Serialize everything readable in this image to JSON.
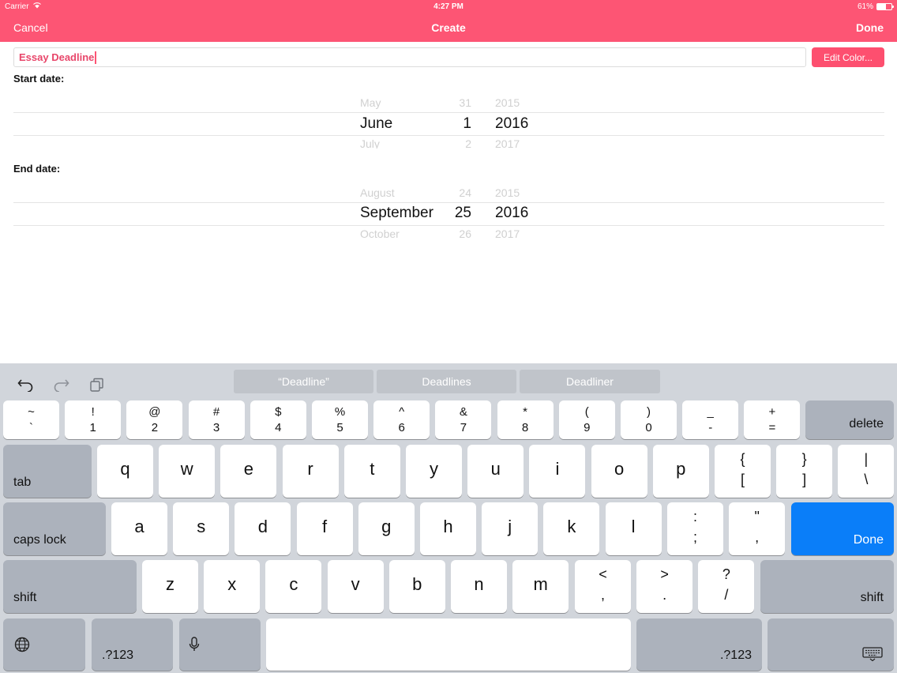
{
  "status_bar": {
    "carrier": "Carrier",
    "time": "4:27 PM",
    "battery_text": "61%",
    "battery_level": 0.61
  },
  "nav": {
    "cancel": "Cancel",
    "title": "Create",
    "done": "Done"
  },
  "form": {
    "name_value": "Essay Deadline",
    "edit_color_label": "Edit Color...",
    "start_label": "Start date:",
    "end_label": "End date:"
  },
  "start_picker": {
    "above": {
      "month": "May",
      "day": "31",
      "year": "2015"
    },
    "selected": {
      "month": "June",
      "day": "1",
      "year": "2016"
    },
    "below": {
      "month": "July",
      "day": "2",
      "year": "2017"
    }
  },
  "end_picker": {
    "above": {
      "month": "August",
      "day": "24",
      "year": "2015"
    },
    "selected": {
      "month": "September",
      "day": "25",
      "year": "2016"
    },
    "below": {
      "month": "October",
      "day": "26",
      "year": "2017"
    }
  },
  "keyboard": {
    "suggestions": [
      "“Deadline”",
      "Deadlines",
      "Deadliner"
    ],
    "row1": [
      {
        "top": "~",
        "bot": "`"
      },
      {
        "top": "!",
        "bot": "1"
      },
      {
        "top": "@",
        "bot": "2"
      },
      {
        "top": "#",
        "bot": "3"
      },
      {
        "top": "$",
        "bot": "4"
      },
      {
        "top": "%",
        "bot": "5"
      },
      {
        "top": "^",
        "bot": "6"
      },
      {
        "top": "&",
        "bot": "7"
      },
      {
        "top": "*",
        "bot": "8"
      },
      {
        "top": "(",
        "bot": "9"
      },
      {
        "top": ")",
        "bot": "0"
      },
      {
        "top": "_",
        "bot": "-"
      },
      {
        "top": "+",
        "bot": "="
      }
    ],
    "delete": "delete",
    "tab": "tab",
    "row2": [
      "q",
      "w",
      "e",
      "r",
      "t",
      "y",
      "u",
      "i",
      "o",
      "p"
    ],
    "row2_symbols": [
      {
        "top": "{",
        "bot": "["
      },
      {
        "top": "}",
        "bot": "]"
      },
      {
        "top": "|",
        "bot": "\\"
      }
    ],
    "caps_lock": "caps lock",
    "row3": [
      "a",
      "s",
      "d",
      "f",
      "g",
      "h",
      "j",
      "k",
      "l"
    ],
    "row3_symbols": [
      {
        "top": ":",
        "bot": ";"
      },
      {
        "top": "\"",
        "bot": ","
      }
    ],
    "done": "Done",
    "shift": "shift",
    "row4": [
      "z",
      "x",
      "c",
      "v",
      "b",
      "n",
      "m"
    ],
    "row4_symbols": [
      {
        "top": "<",
        "bot": ","
      },
      {
        "top": ">",
        "bot": "."
      },
      {
        "top": "?",
        "bot": "/"
      }
    ],
    "numbers": ".?123",
    "icons": [
      "undo-icon",
      "redo-icon",
      "paste-icon",
      "globe-icon",
      "microphone-icon",
      "keyboard-dismiss-icon"
    ]
  },
  "colors": {
    "accent": "#fd5574",
    "done_key": "#0a7ef9",
    "keyboard_bg": "#d1d5db"
  }
}
